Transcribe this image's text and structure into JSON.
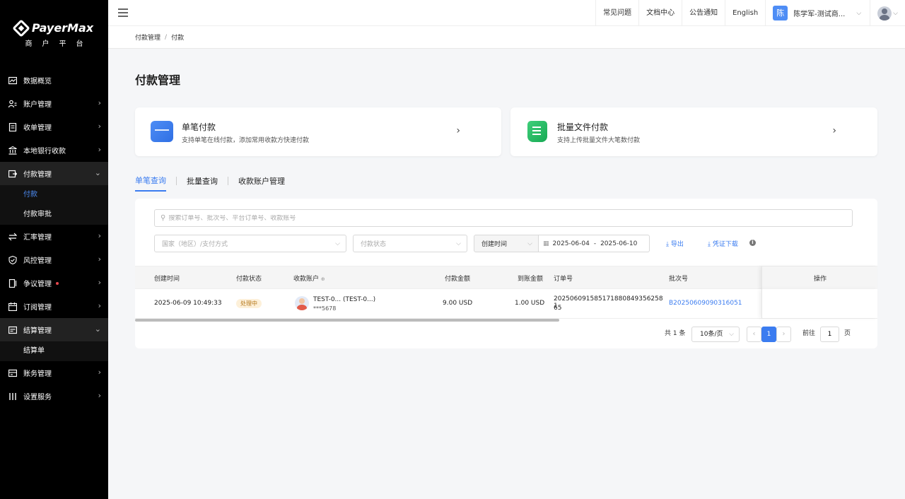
{
  "brand": {
    "name": "PayerMax",
    "subtitle": "商户平台"
  },
  "sidebar": {
    "items": [
      {
        "label": "数据概览",
        "icon": "chart-icon"
      },
      {
        "label": "账户管理",
        "icon": "user-icon"
      },
      {
        "label": "收单管理",
        "icon": "document-icon"
      },
      {
        "label": "本地银行收款",
        "icon": "bank-icon"
      },
      {
        "label": "付款管理",
        "icon": "payment-icon"
      },
      {
        "label": "汇率管理",
        "icon": "exchange-icon"
      },
      {
        "label": "风控管理",
        "icon": "shield-icon"
      },
      {
        "label": "争议管理",
        "icon": "dispute-icon"
      },
      {
        "label": "订阅管理",
        "icon": "calendar-icon"
      },
      {
        "label": "结算管理",
        "icon": "settlement-icon"
      },
      {
        "label": "账务管理",
        "icon": "ledger-icon"
      },
      {
        "label": "设置服务",
        "icon": "settings-icon"
      }
    ],
    "payment_sub": [
      "付款",
      "付款审批"
    ],
    "settlement_sub": [
      "结算单"
    ]
  },
  "topbar": {
    "links": [
      "常见问题",
      "文档中心",
      "公告通知",
      "English"
    ],
    "user_initial": "陈",
    "user_name": "陈学军-测试商..."
  },
  "breadcrumb": [
    "付款管理",
    "/",
    "付款"
  ],
  "page_title": "付款管理",
  "cards": [
    {
      "title": "单笔付款",
      "desc": "支持单笔在线付款，添加常用收款方快速付款"
    },
    {
      "title": "批量文件付款",
      "desc": "支持上传批量文件大笔数付款"
    }
  ],
  "tabs": [
    "单笔查询",
    "批量查询",
    "收款账户管理"
  ],
  "filters": {
    "search_placeholder": "搜索订单号、批次号、平台订单号、收款账号",
    "country_placeholder": "国家（地区）/支付方式",
    "status_placeholder": "付款状态",
    "date_type": "创建时间",
    "date_start": "2025-06-04",
    "date_sep": "-",
    "date_end": "2025-06-10",
    "export_label": "导出",
    "voucher_label": "凭证下载",
    "info": "i"
  },
  "table": {
    "headers": [
      "创建时间",
      "付款状态",
      "收款账户",
      "付款金额",
      "到账金额",
      "订单号",
      "批次号",
      "操作"
    ],
    "rows": [
      {
        "created": "2025-06-09 10:49:33",
        "status": "处理中",
        "account_name": "TEST-0... (TEST-0...)",
        "account_no": "***5678",
        "pay_amount": "9.00 USD",
        "recv_amount": "1.00 USD",
        "order_no_1": "20250609158517188084935625​81",
        "order_no_2": "65",
        "batch_no": "B20250609090316051"
      }
    ]
  },
  "pagination": {
    "total": "共 1 条",
    "page_size": "10条/页",
    "current": "1",
    "goto_label": "前往",
    "goto_value": "1",
    "page_suffix": "页"
  },
  "colors": {
    "accent": "#3b7cf0",
    "sidebar_bg": "#000000",
    "status_bg": "#fdf0d9"
  }
}
